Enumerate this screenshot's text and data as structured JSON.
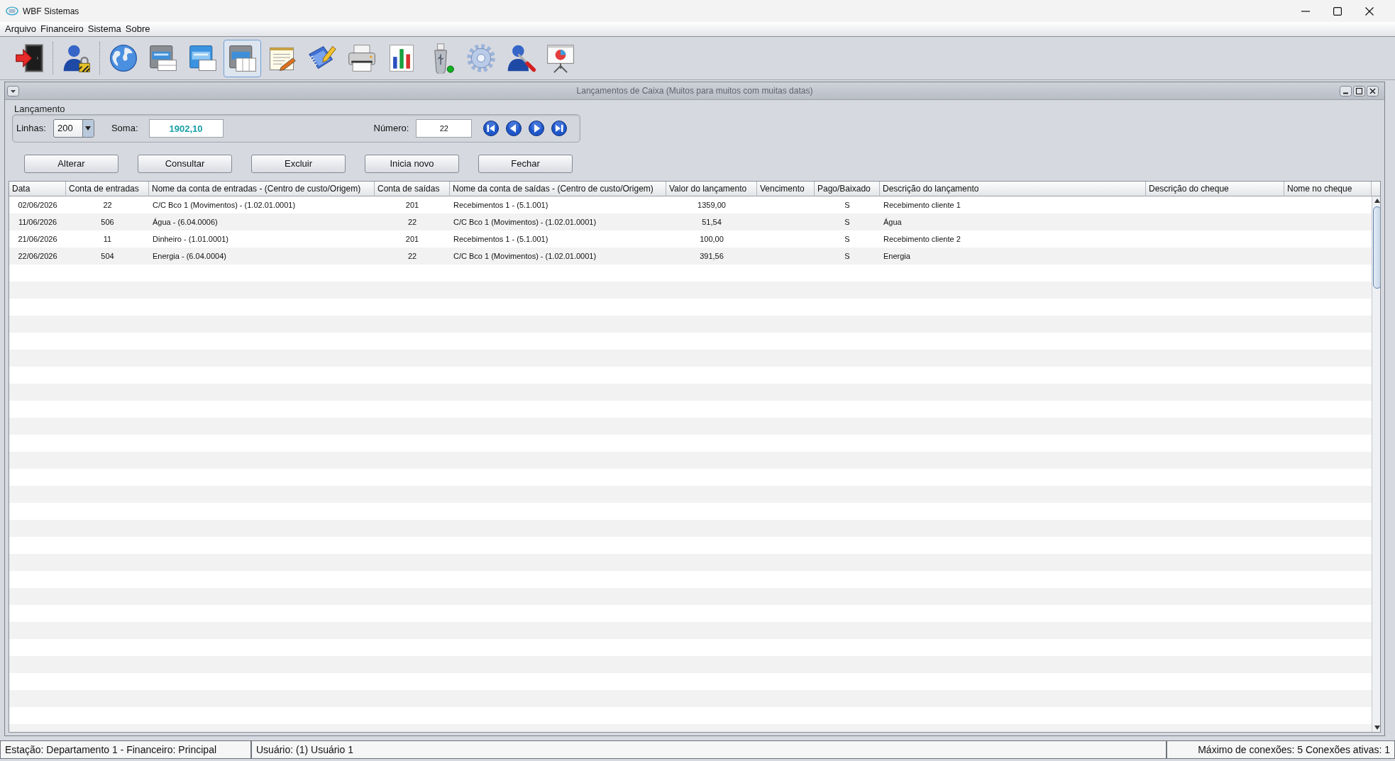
{
  "window": {
    "title": "WBF Sistemas"
  },
  "menu": [
    {
      "label": "Arquivo"
    },
    {
      "label": "Financeiro"
    },
    {
      "label": "Sistema"
    },
    {
      "label": "Sobre"
    }
  ],
  "toolbar": {
    "groups": [
      [
        {
          "selected": false
        }
      ],
      [
        {
          "selected": false
        }
      ],
      [
        {
          "selected": false
        },
        {
          "selected": false
        },
        {
          "selected": false
        },
        {
          "selected": true
        },
        {
          "selected": false
        },
        {
          "selected": false
        },
        {
          "selected": false
        },
        {
          "selected": false
        },
        {
          "selected": false
        },
        {
          "selected": false
        },
        {
          "selected": false
        },
        {
          "selected": false
        }
      ]
    ]
  },
  "internal_frame": {
    "title": "Lançamentos de Caixa (Muitos para muitos com muitas datas)",
    "active": false,
    "group": {
      "title": "Lançamento",
      "lines": {
        "label": "Linhas:",
        "value": "200"
      },
      "sum": {
        "label": "Soma:",
        "value": "1902,10"
      },
      "number": {
        "label": "Número:",
        "value": "22"
      }
    },
    "buttons": [
      {
        "label": "Alterar"
      },
      {
        "label": "Consultar"
      },
      {
        "label": "Excluir"
      },
      {
        "label": "Inicia novo"
      },
      {
        "label": "Fechar"
      }
    ],
    "table": {
      "columns": [
        "Data",
        "Conta de entradas",
        "Nome da conta de entradas - (Centro de custo/Origem)",
        "Conta de saídas",
        "Nome da conta de saídas - (Centro de custo/Origem)",
        "Valor do lançamento",
        "Vencimento",
        "Pago/Baixado",
        "Descrição do lançamento",
        "Descrição do cheque",
        "Nome no cheque"
      ],
      "rows": [
        {
          "selected": false,
          "cells": [
            "02/06/2026",
            "22",
            "C/C Bco 1 (Movimentos) - (1.02.01.0001)",
            "201",
            "Recebimentos 1 - (5.1.001)",
            "1359,00",
            null,
            "S",
            "Recebimento cliente 1",
            null,
            null
          ]
        },
        {
          "selected": false,
          "cells": [
            "11/06/2026",
            "506",
            "Água - (6.04.0006)",
            "22",
            "C/C Bco 1 (Movimentos) - (1.02.01.0001)",
            "51,54",
            null,
            "S",
            "Água",
            null,
            null
          ]
        },
        {
          "selected": false,
          "cells": [
            "21/06/2026",
            "11",
            "Dinheiro - (1.01.0001)",
            "201",
            "Recebimentos 1 - (5.1.001)",
            "100,00",
            null,
            "S",
            "Recebimento cliente 2",
            null,
            null
          ]
        },
        {
          "selected": false,
          "cells": [
            "22/06/2026",
            "504",
            "Energia - (6.04.0004)",
            "22",
            "C/C Bco 1 (Movimentos) - (1.02.01.0001)",
            "391,56",
            null,
            "S",
            "Energia",
            null,
            null
          ]
        }
      ]
    }
  },
  "status_bar": [
    "Estação: Departamento 1 - Financeiro: Principal",
    "Usuário: (1) Usuário 1",
    "Máximo de conexões: 5 Conexões ativas: 1"
  ]
}
